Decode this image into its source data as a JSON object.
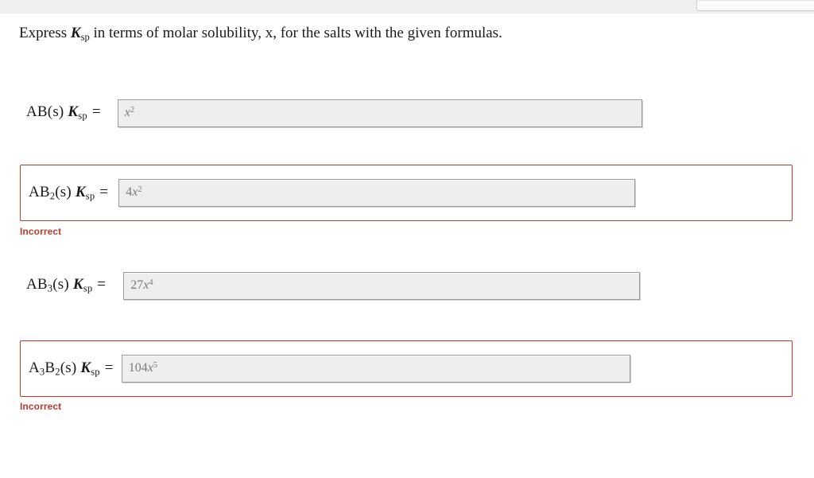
{
  "window": {
    "top_panel_present": true
  },
  "prompt": {
    "prefix": "Express ",
    "symbol": "K",
    "symbol_sub": "sp",
    "rest": " in terms of molar solubility, x, for the salts with the given formulas."
  },
  "colors": {
    "page_background": "#ffffff",
    "top_strip": "#efeff0",
    "input_fill": "#eeeeee",
    "input_border": "#9b9b9b",
    "input_text": "#7a7a7a",
    "error_border": "#c0392b",
    "error_text": "#c0392b",
    "body_text": "#1a1a1a"
  },
  "questions": [
    {
      "formula_a": "AB",
      "formula_a_sub": "",
      "formula_b": "",
      "formula_b_sub": "",
      "state": "(s)",
      "constant": "K",
      "constant_sub": "sp",
      "equals": "=",
      "answer_coefficient": "",
      "answer_variable": "x",
      "answer_exponent": "2",
      "answer_text": "x2",
      "status": "",
      "flagged": false
    },
    {
      "formula_a": "AB",
      "formula_a_sub": "2",
      "formula_b": "",
      "formula_b_sub": "",
      "state": "(s)",
      "constant": "K",
      "constant_sub": "sp",
      "equals": "=",
      "answer_coefficient": "4",
      "answer_variable": "x",
      "answer_exponent": "2",
      "answer_text": "4x2",
      "status": "Incorrect",
      "flagged": true
    },
    {
      "formula_a": "AB",
      "formula_a_sub": "3",
      "formula_b": "",
      "formula_b_sub": "",
      "state": "(s)",
      "constant": "K",
      "constant_sub": "sp",
      "equals": "=",
      "answer_coefficient": "27",
      "answer_variable": "x",
      "answer_exponent": "4",
      "answer_text": "27x4",
      "status": "",
      "flagged": false
    },
    {
      "formula_a": "A",
      "formula_a_sub": "3",
      "formula_b": "B",
      "formula_b_sub": "2",
      "state": "(s)",
      "constant": "K",
      "constant_sub": "sp",
      "equals": "=",
      "answer_coefficient": "104",
      "answer_variable": "x",
      "answer_exponent": "5",
      "answer_text": "104x5",
      "status": "Incorrect",
      "flagged": true
    }
  ]
}
